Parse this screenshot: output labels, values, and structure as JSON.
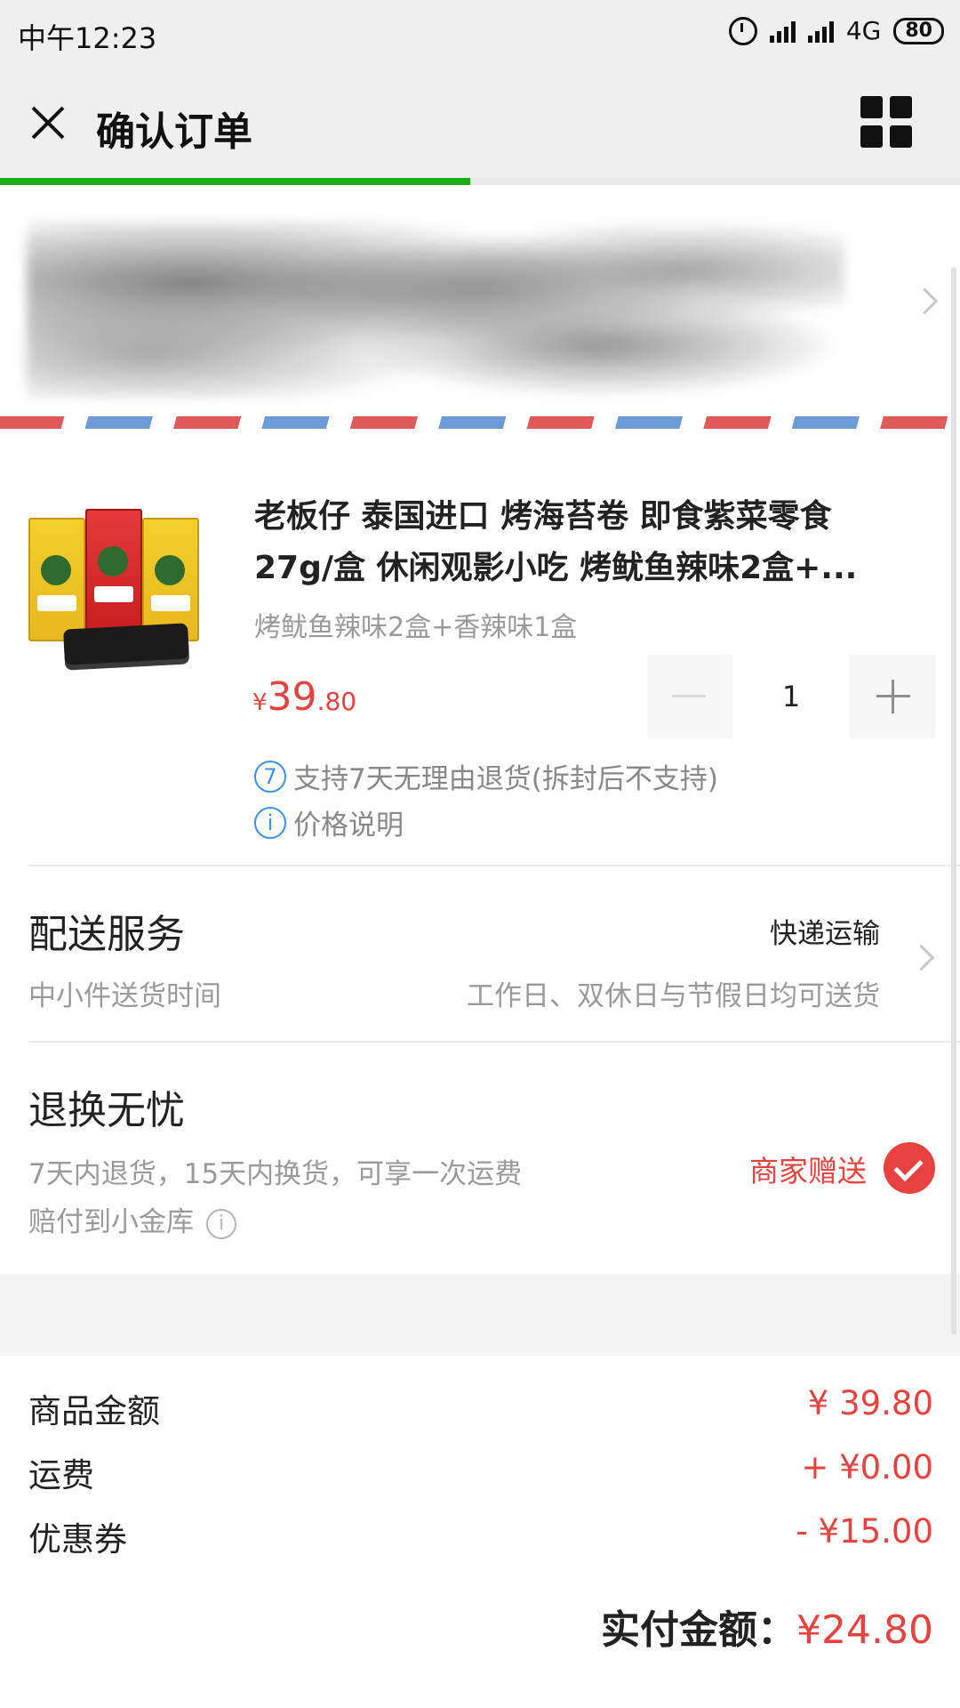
{
  "status_bar": {
    "time": "中午12:23",
    "network": "4G",
    "battery": "80"
  },
  "nav": {
    "title": "确认订单",
    "progress_fraction": 0.49
  },
  "product": {
    "title_line1": "老板仔 泰国进口 烤海苔卷 即食紫菜零食",
    "title_line2": "27g/盒 休闲观影小吃 烤鱿鱼辣味2盒+...",
    "spec": "烤鱿鱼辣味2盒+香辣味1盒",
    "price_currency": "¥",
    "price_int": "39",
    "price_dec": ".80",
    "quantity": "1",
    "policy_badge": "7",
    "policy_text": "支持7天无理由退货(拆封后不支持)",
    "info_badge": "i",
    "price_note": "价格说明"
  },
  "delivery": {
    "title": "配送服务",
    "method": "快递运输",
    "sub_left": "中小件送货时间",
    "sub_right": "工作日、双休日与节假日均可送货"
  },
  "returns": {
    "title": "退换无忧",
    "desc_line1": "7天内退货，15天内换货，可享一次运费",
    "desc_line2": "赔付到小金库",
    "info_badge": "i",
    "gift_label": "商家赠送"
  },
  "summary": {
    "goods_label": "商品金额",
    "goods_value": "¥ 39.80",
    "shipping_label": "运费",
    "shipping_value": "+ ¥0.00",
    "coupon_label": "优惠券",
    "coupon_value": "- ¥15.00",
    "total_label": "实付金额：",
    "total_value": "¥24.80"
  },
  "colors": {
    "accent_red": "#e64340",
    "progress_green": "#1aad19",
    "info_blue": "#3a92e6"
  }
}
